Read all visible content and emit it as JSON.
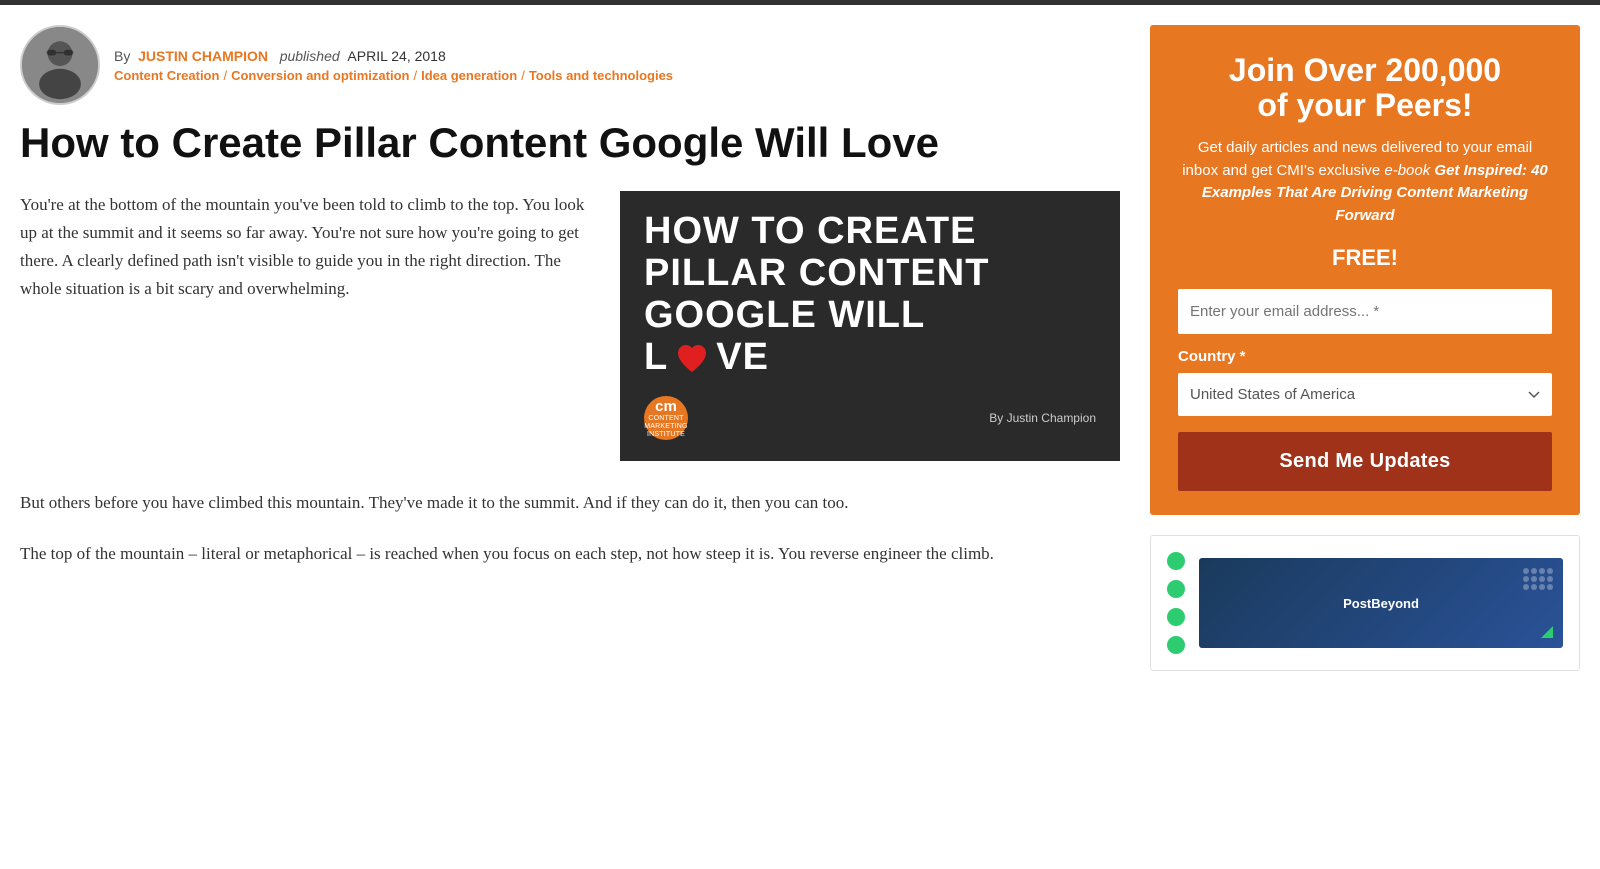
{
  "topBorder": true,
  "author": {
    "name": "JUSTIN CHAMPION",
    "byline_prefix": "By",
    "published_label": "published",
    "pub_date": "APRIL 24, 2018"
  },
  "categories": [
    {
      "label": "Content Creation",
      "sep": true
    },
    {
      "label": "Conversion and optimization",
      "sep": true
    },
    {
      "label": "Idea generation",
      "sep": true
    },
    {
      "label": "Tools and technologies",
      "sep": false
    }
  ],
  "article": {
    "title": "How to Create Pillar Content Google Will Love",
    "paragraph1": "You're at the bottom of the mountain you've been told to climb to the top. You look up at the summit and it seems so far away. You're not sure how you're going to get there. A clearly defined path isn't visible to guide you in the right direction. The whole situation is a bit scary and overwhelming.",
    "paragraph2": "But others before you have climbed this mountain. They've made it to the summit. And if they can do it, then you can too.",
    "paragraph3": "The top of the mountain – literal or metaphorical – is reached when you focus on each step, not how steep it is. You reverse engineer the climb."
  },
  "image_card": {
    "line1": "HOW TO CREATE",
    "line2": "PILLAR CONTENT",
    "line3": "GOOGLE WILL",
    "line4_pre": "L",
    "line4_post": "VE",
    "byline": "By Justin Champion",
    "cm_logo_top": "cm",
    "cm_logo_sub": "CONTENT\nMARKETING\nINSTITUTE"
  },
  "sidebar": {
    "widget1": {
      "heading1": "Join Over 200,000",
      "heading2": "of your Peers!",
      "description1": "Get daily articles and news delivered to your email inbox and get CMI's exclusive ",
      "description2": "e-book ",
      "description3": "Get Inspired: 40 Examples That Are Driving Content Marketing Forward",
      "free_label": "FREE!",
      "email_placeholder": "Enter your email address... *",
      "country_label": "Country *",
      "country_default": "United States of America",
      "submit_label": "Send Me Updates"
    }
  }
}
